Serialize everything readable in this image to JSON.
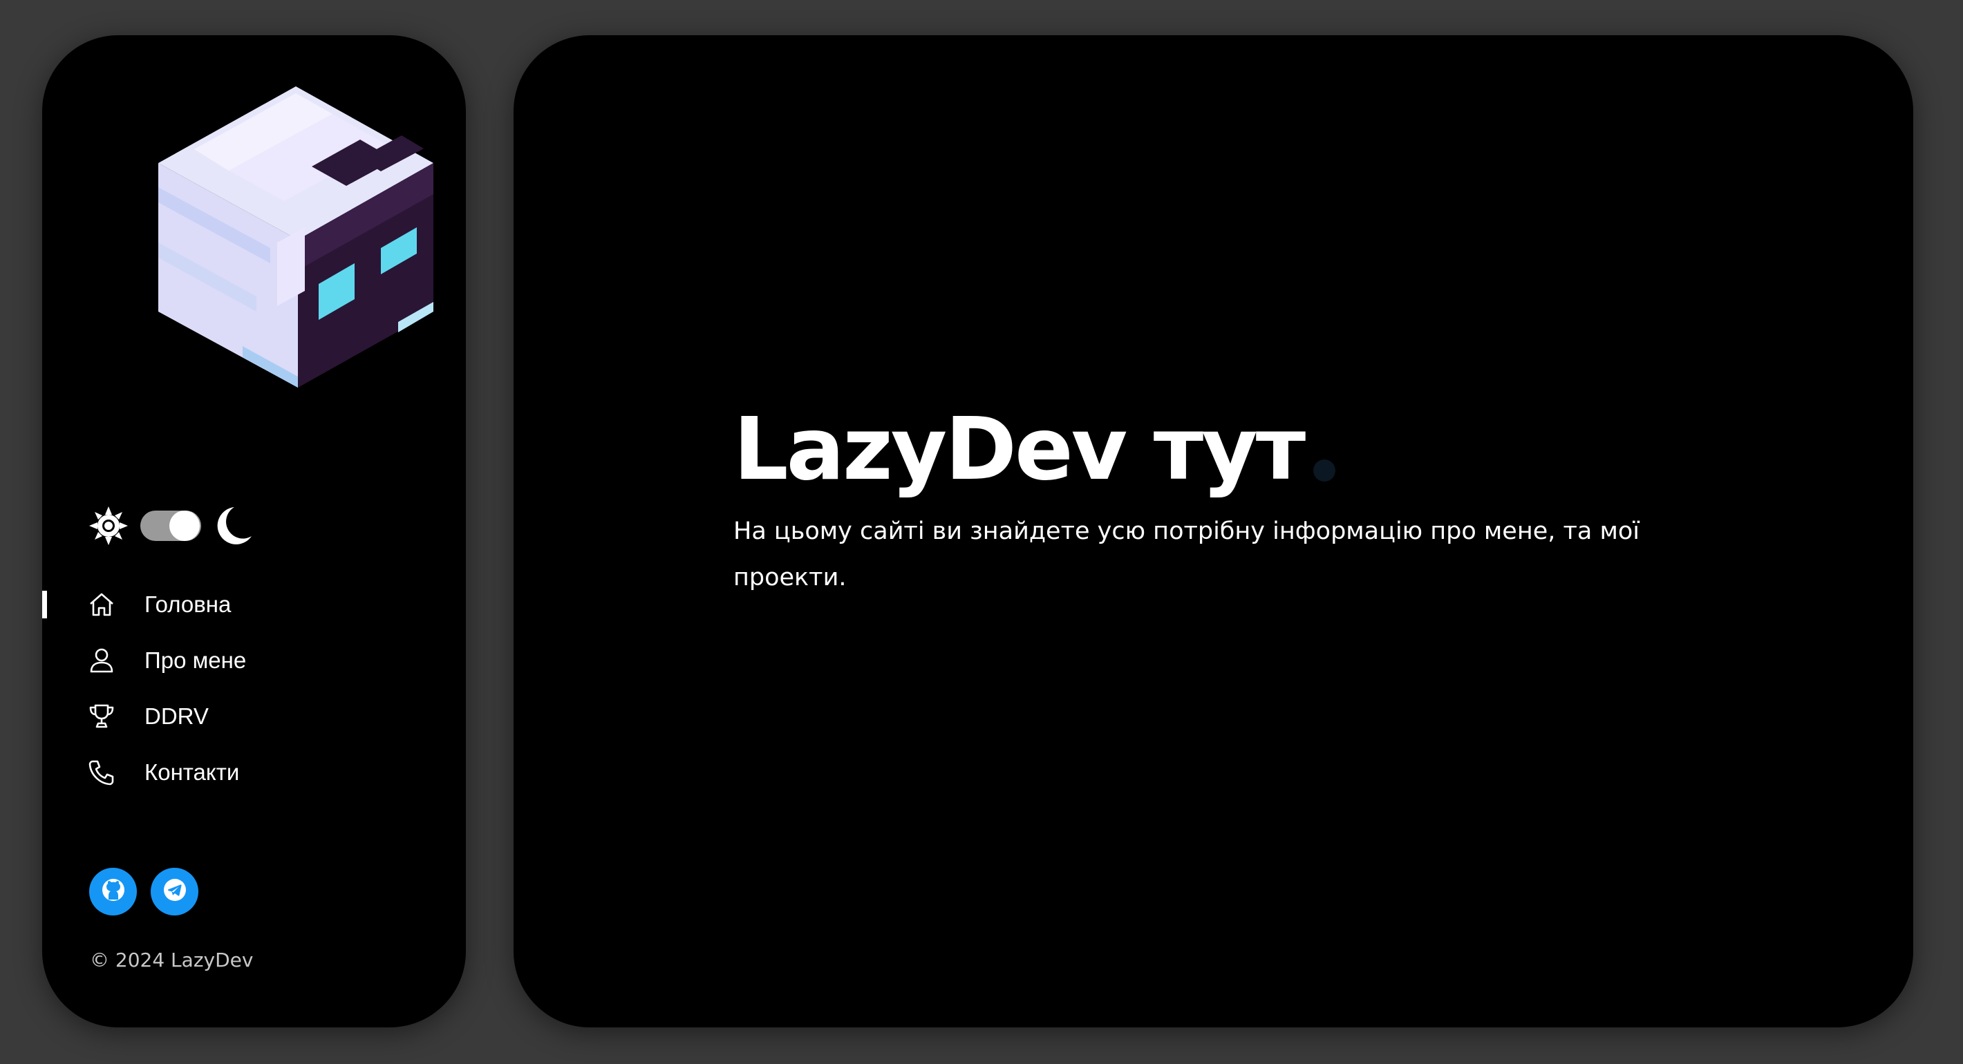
{
  "theme": {
    "mode": "dark",
    "accent": "#1596f5",
    "sun_icon": "sun-icon",
    "moon_icon": "moon-icon"
  },
  "sidebar": {
    "avatar": "pixel-cube-avatar",
    "nav": [
      {
        "label": "Головна",
        "icon": "home-icon",
        "active": true
      },
      {
        "label": "Про мене",
        "icon": "user-icon",
        "active": false
      },
      {
        "label": "DDRV",
        "icon": "trophy-icon",
        "active": false
      },
      {
        "label": "Контакти",
        "icon": "phone-icon",
        "active": false
      }
    ],
    "socials": [
      {
        "icon": "github-icon"
      },
      {
        "icon": "telegram-icon"
      }
    ],
    "copyright": "© 2024 LazyDev"
  },
  "main": {
    "title": "LazyDev тут",
    "subtitle": "На цьому сайті ви знайдете усю потрібну інформацію про мене, та мої проекти."
  }
}
